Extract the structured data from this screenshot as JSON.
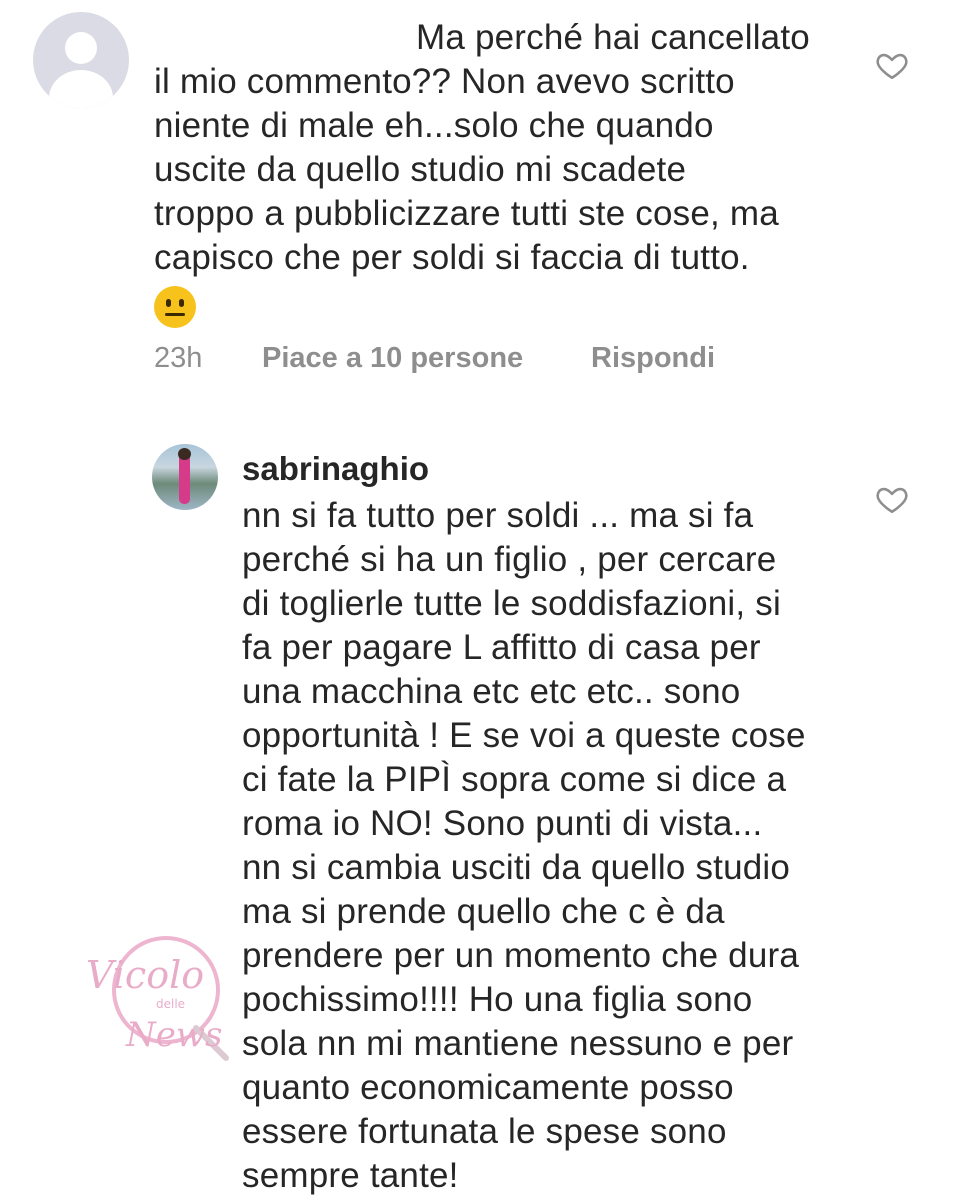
{
  "comment1": {
    "avatar_icon": "default-user-avatar-icon",
    "lines": [
      "Ma perché hai cancellato",
      "il mio commento?? Non avevo scritto",
      "niente di male eh...solo che quando",
      "uscite da quello studio mi scadete",
      "troppo a pubblicizzare tutti ste cose, ma",
      "capisco che per soldi si faccia di tutto."
    ],
    "emoji": "neutral-face-emoji",
    "time": "23h",
    "likes": "Piace a 10 persone",
    "reply": "Rispondi",
    "like_icon": "heart-outline-icon"
  },
  "comment2": {
    "username": "sabrinaghio",
    "avatar_icon": "profile-photo-avatar",
    "lines": [
      "nn si fa tutto per soldi ... ma si fa",
      "perché si ha un figlio , per cercare",
      "di toglierle tutte le soddisfazioni, si",
      "fa per pagare L affitto di casa per",
      "una macchina etc etc etc.. sono",
      "opportunità ! E se voi a queste cose",
      "ci fate la PIPÌ sopra come si dice a",
      "roma io NO! Sono punti di vista...",
      "nn si cambia usciti da quello studio",
      "ma si prende quello che c è da",
      "prendere per un momento che dura",
      "pochissimo!!!! Ho una figlia sono",
      "sola nn mi mantiene nessuno e per",
      "quanto economicamente posso",
      "essere fortunata le spese sono",
      "sempre tante!"
    ],
    "like_icon": "heart-outline-icon"
  },
  "watermark": {
    "text_main": "Vicolo",
    "text_small": "delle",
    "text_bottom": "News"
  },
  "colors": {
    "text": "#262626",
    "meta": "#8e8e8e",
    "avatar_default_bg": "#dbdbe5",
    "emoji": "#f7c21c"
  }
}
